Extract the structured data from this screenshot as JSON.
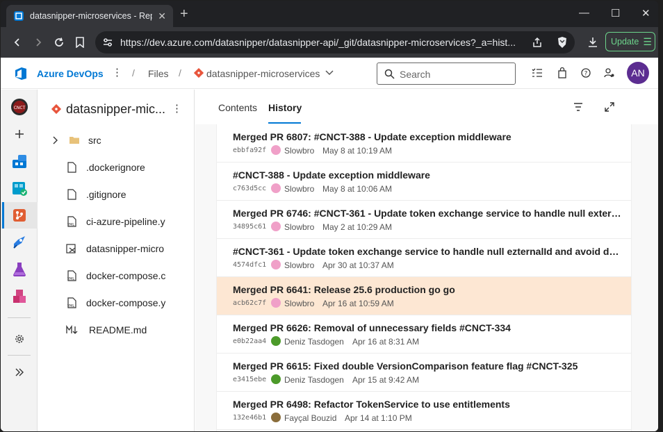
{
  "browser": {
    "tab_title": "datasnipper-microservices - Repos",
    "url": "https://dev.azure.com/datasnipper/datasnipper-api/_git/datasnipper-microservices?_a=hist...",
    "update_label": "Update"
  },
  "header": {
    "brand": "Azure DevOps",
    "breadcrumb_files": "Files",
    "breadcrumb_repo": "datasnipper-microservices",
    "search_placeholder": "Search",
    "avatar_initials": "AN"
  },
  "tree": {
    "repo_name": "datasnipper-mic...",
    "items": [
      {
        "label": "src",
        "type": "folder"
      },
      {
        "label": ".dockerignore",
        "type": "file"
      },
      {
        "label": ".gitignore",
        "type": "file"
      },
      {
        "label": "ci-azure-pipeline.y",
        "type": "yml"
      },
      {
        "label": "datasnipper-micro",
        "type": "sln"
      },
      {
        "label": "docker-compose.c",
        "type": "yml"
      },
      {
        "label": "docker-compose.y",
        "type": "yml"
      },
      {
        "label": "README.md",
        "type": "md"
      }
    ]
  },
  "main": {
    "tabs": [
      "Contents",
      "History"
    ],
    "active_tab": "History"
  },
  "commits": [
    {
      "message": "Merged PR 6807: #CNCT-388 - Update exception middleware",
      "hash": "ebbfa92f",
      "author": "Slowbro",
      "date": "May 8 at 10:19 AM",
      "avatar_color": "#f0a0c8"
    },
    {
      "message": "#CNCT-388 - Update exception middleware",
      "hash": "c763d5cc",
      "author": "Slowbro",
      "date": "May 8 at 10:06 AM",
      "avatar_color": "#f0a0c8"
    },
    {
      "message": "Merged PR 6746: #CNCT-361 - Update token exchange service to handle null externa...",
      "hash": "34895c61",
      "author": "Slowbro",
      "date": "May 2 at 10:29 AM",
      "avatar_color": "#f0a0c8"
    },
    {
      "message": "#CNCT-361 - Update token exchange service to handle null ezternalId and avoid dupl...",
      "hash": "4574dfc1",
      "author": "Slowbro",
      "date": "Apr 30 at 10:37 AM",
      "avatar_color": "#f0a0c8"
    },
    {
      "message": "Merged PR 6641: Release 25.6 production go go",
      "hash": "acb62c7f",
      "author": "Slowbro",
      "date": "Apr 16 at 10:59 AM",
      "avatar_color": "#f0a0c8",
      "selected": true
    },
    {
      "message": "Merged PR 6626: Removal of unnecessary fields #CNCT-334",
      "hash": "e0b22aa4",
      "author": "Deniz Tasdogen",
      "date": "Apr 16 at 8:31 AM",
      "avatar_color": "#4c9a2a"
    },
    {
      "message": "Merged PR 6615: Fixed double VersionComparison feature flag #CNCT-325",
      "hash": "e3415ebe",
      "author": "Deniz Tasdogen",
      "date": "Apr 15 at 9:42 AM",
      "avatar_color": "#4c9a2a"
    },
    {
      "message": "Merged PR 6498: Refactor TokenService to use entitlements",
      "hash": "132e46b1",
      "author": "Fayçal Bouzid",
      "date": "Apr 14 at 1:10 PM",
      "avatar_color": "#8a6d3b"
    }
  ],
  "colors": {
    "accent": "#0078d4",
    "selected_row": "#fde7d3",
    "avatar_bg": "#5c2d91"
  }
}
